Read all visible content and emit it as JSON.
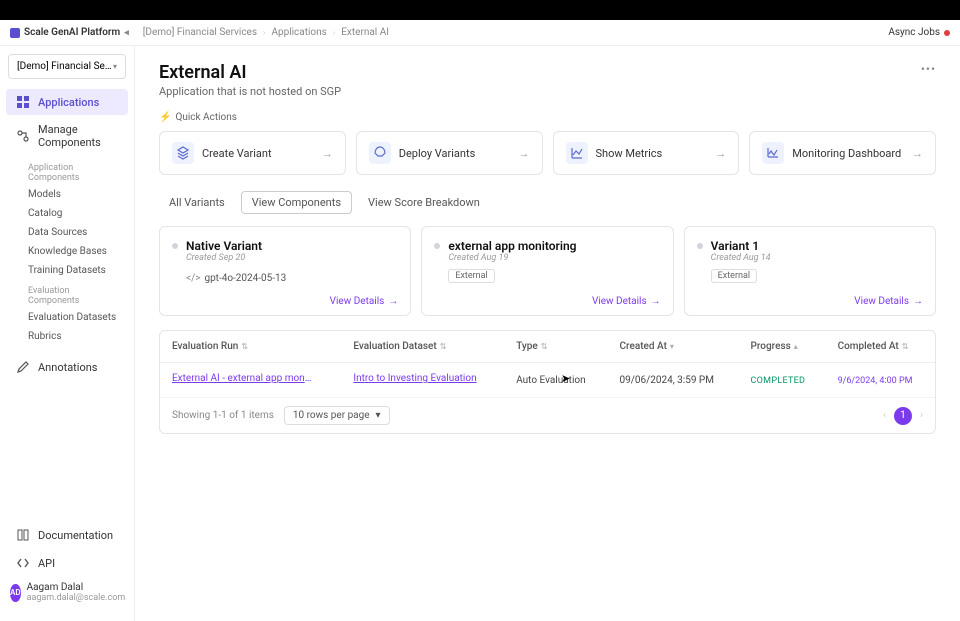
{
  "platform": "Scale GenAI Platform",
  "breadcrumbs": [
    "[Demo] Financial Services",
    "Applications",
    "External AI"
  ],
  "async_jobs": "Async Jobs",
  "workspace": "[Demo] Financial Servi...",
  "nav": {
    "applications": "Applications",
    "manage_components": "Manage Components",
    "section_app": "Application Components",
    "models": "Models",
    "catalog": "Catalog",
    "data_sources": "Data Sources",
    "knowledge_bases": "Knowledge Bases",
    "training_datasets": "Training Datasets",
    "section_eval": "Evaluation Components",
    "evaluation_datasets": "Evaluation Datasets",
    "rubrics": "Rubrics",
    "annotations": "Annotations",
    "documentation": "Documentation",
    "api": "API"
  },
  "user": {
    "initials": "AD",
    "name": "Aagam Dalal",
    "email": "aagam.dalal@scale.com"
  },
  "page": {
    "title": "External AI",
    "subtitle": "Application that is not hosted on SGP",
    "quick_actions_label": "Quick Actions"
  },
  "actions": {
    "create_variant": "Create Variant",
    "deploy_variants": "Deploy Variants",
    "show_metrics": "Show Metrics",
    "monitoring_dashboard": "Monitoring Dashboard"
  },
  "tabs": {
    "all_variants": "All Variants",
    "view_components": "View Components",
    "view_score_breakdown": "View Score Breakdown"
  },
  "variants": [
    {
      "name": "Native Variant",
      "date": "Created Sep 20",
      "model": "gpt-4o-2024-05-13",
      "external": false
    },
    {
      "name": "external app monitoring",
      "date": "Created Aug 19",
      "external": true,
      "external_label": "External"
    },
    {
      "name": "Variant 1",
      "date": "Created Aug 14",
      "external": true,
      "external_label": "External"
    }
  ],
  "view_details": "View Details",
  "table": {
    "headers": {
      "run": "Evaluation Run",
      "dataset": "Evaluation Dataset",
      "type": "Type",
      "created": "Created At",
      "progress": "Progress",
      "completed": "Completed At"
    },
    "rows": [
      {
        "run": "External AI - external app monito...",
        "dataset": "Intro to Investing Evaluation",
        "type": "Auto Evaluation",
        "created": "09/06/2024, 3:59 PM",
        "progress": "COMPLETED",
        "completed": "9/6/2024, 4:00 PM"
      }
    ],
    "footer": {
      "showing": "Showing 1-1 of 1 items",
      "rows_per_page": "10 rows per page",
      "current_page": "1"
    }
  }
}
